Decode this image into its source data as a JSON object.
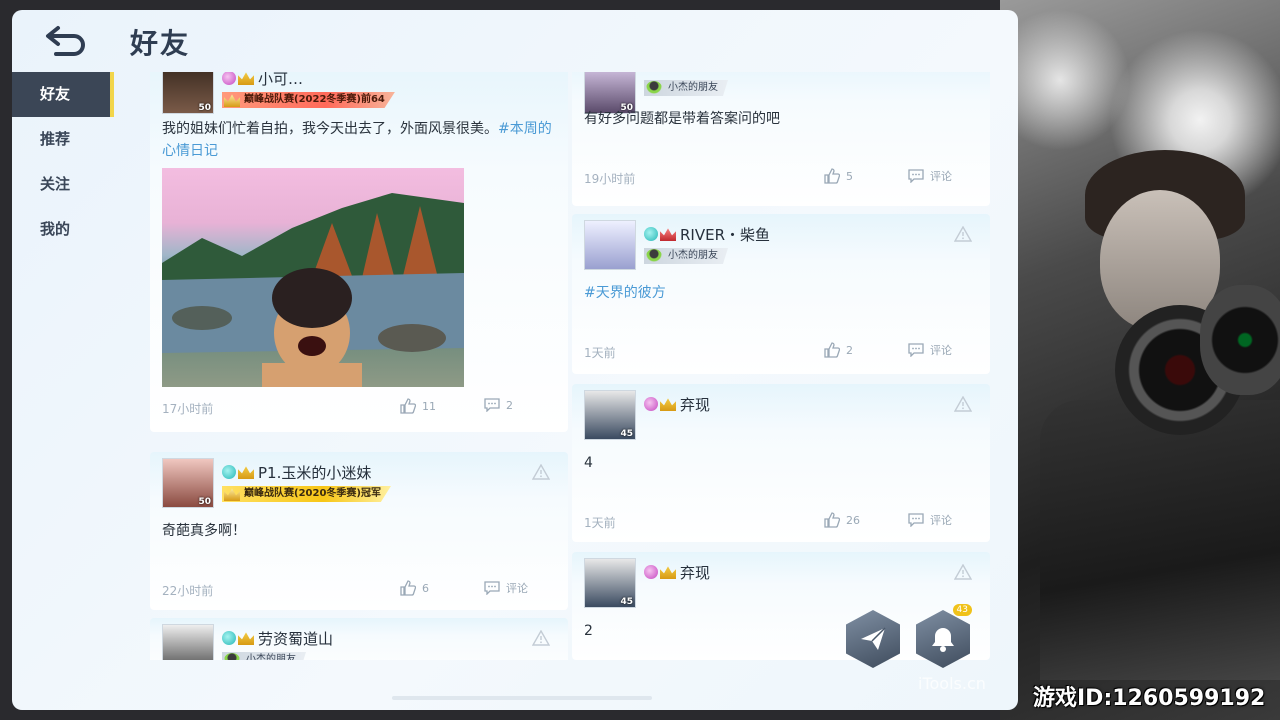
{
  "header": {
    "title": "好友"
  },
  "sidebar": {
    "items": [
      {
        "label": "好友",
        "active": true
      },
      {
        "label": "推荐",
        "active": false
      },
      {
        "label": "关注",
        "active": false
      },
      {
        "label": "我的",
        "active": false
      }
    ]
  },
  "posts_left": [
    {
      "username": "小可…",
      "level": "50",
      "tag": "巅峰战队赛(2022冬季赛)前64",
      "text": "我的姐妹们忙着自拍，我今天出去了，外面风景很美。",
      "hashtag": "#本周的心情日记",
      "time": "17小时前",
      "likes": "11",
      "comments": "2"
    },
    {
      "username": "P1.玉米的小迷妹",
      "level": "50",
      "tag": "巅峰战队赛(2020冬季赛)冠军",
      "text": "奇葩真多啊！",
      "time": "22小时前",
      "likes": "6",
      "comments": "评论"
    },
    {
      "username": "劳资蜀道山",
      "tag": "小杰的朋友"
    }
  ],
  "posts_right": [
    {
      "level": "50",
      "tag": "小杰的朋友",
      "text": "有好多问题都是带着答案问的吧",
      "time": "19小时前",
      "likes": "5",
      "comments": "评论"
    },
    {
      "username": "RIVER・柴鱼",
      "tag": "小杰的朋友",
      "hashtag": "#天界的彼方",
      "time": "1天前",
      "likes": "2",
      "comments": "评论"
    },
    {
      "username": "弃现",
      "level": "45",
      "text": "4",
      "time": "1天前",
      "likes": "26",
      "comments": "评论"
    },
    {
      "username": "弃现",
      "level": "45",
      "text": "2"
    }
  ],
  "notifications": {
    "count": "43"
  },
  "watermark": "iTools.cn",
  "game_id": "游戏ID:1260599192"
}
